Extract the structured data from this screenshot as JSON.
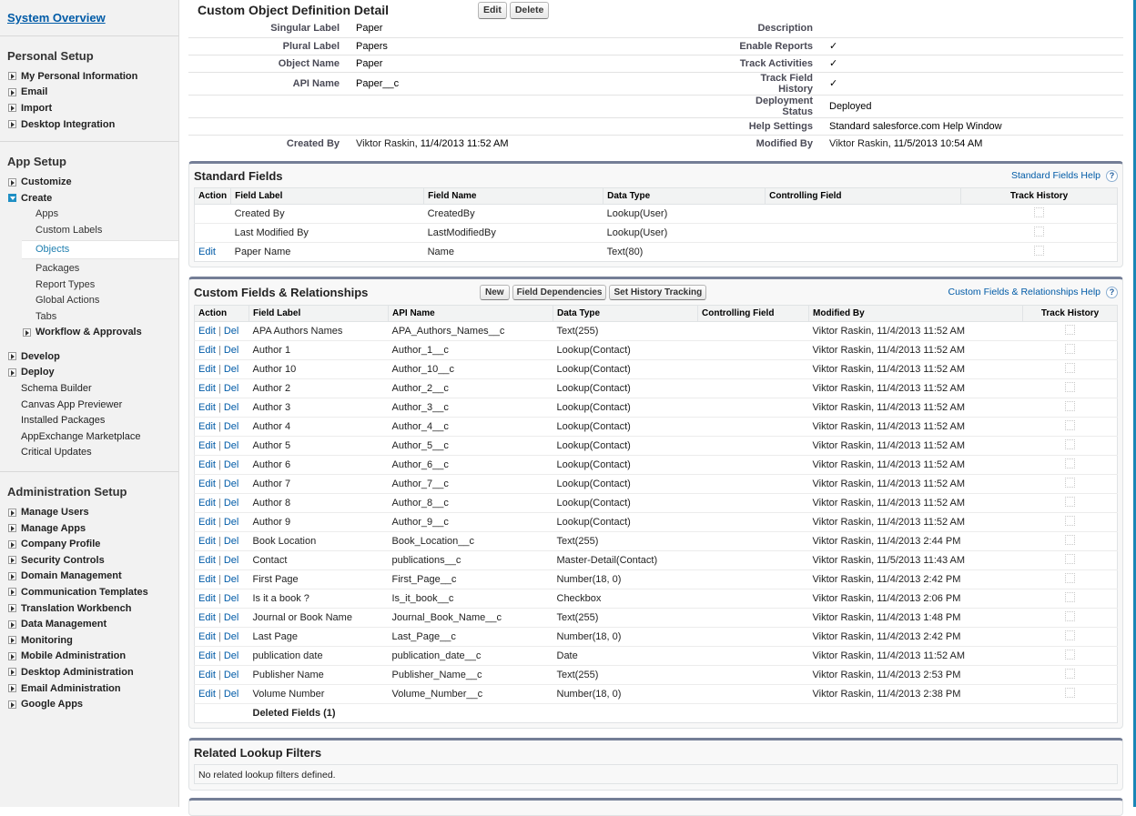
{
  "sidebar": {
    "system_overview": "System Overview",
    "personal_setup": {
      "heading": "Personal Setup",
      "items": [
        "My Personal Information",
        "Email",
        "Import",
        "Desktop Integration"
      ]
    },
    "app_setup": {
      "heading": "App Setup",
      "customize": "Customize",
      "create": "Create",
      "create_children": [
        "Apps",
        "Custom Labels",
        "Objects",
        "Packages",
        "Report Types",
        "Global Actions",
        "Tabs"
      ],
      "workflow": "Workflow & Approvals",
      "develop": "Develop",
      "deploy": "Deploy",
      "plain_items": [
        "Schema Builder",
        "Canvas App Previewer",
        "Installed Packages",
        "AppExchange Marketplace",
        "Critical Updates"
      ]
    },
    "admin_setup": {
      "heading": "Administration Setup",
      "items": [
        "Manage Users",
        "Manage Apps",
        "Company Profile",
        "Security Controls",
        "Domain Management",
        "Communication Templates",
        "Translation Workbench",
        "Data Management",
        "Monitoring",
        "Mobile Administration",
        "Desktop Administration",
        "Email Administration",
        "Google Apps"
      ]
    }
  },
  "detail": {
    "title": "Custom Object Definition Detail",
    "edit_label": "Edit",
    "delete_label": "Delete",
    "left": [
      {
        "label": "Singular Label",
        "value": "Paper"
      },
      {
        "label": "Plural Label",
        "value": "Papers"
      },
      {
        "label": "Object Name",
        "value": "Paper"
      },
      {
        "label": "API Name",
        "value": "Paper__c"
      },
      {
        "label": "",
        "value": ""
      },
      {
        "label": "",
        "value": ""
      }
    ],
    "right": [
      {
        "label": "Description",
        "value": ""
      },
      {
        "label": "Enable Reports",
        "value": "✓"
      },
      {
        "label": "Track Activities",
        "value": "✓"
      },
      {
        "label": "Track Field History",
        "value": "✓"
      },
      {
        "label": "Deployment Status",
        "value": "Deployed"
      },
      {
        "label": "Help Settings",
        "value": "Standard salesforce.com Help Window"
      }
    ],
    "created_by_label": "Created By",
    "created_by_user": "Viktor Raskin",
    "created_by_date": ", 11/4/2013 11:52 AM",
    "modified_by_label": "Modified By",
    "modified_by_user": "Viktor Raskin",
    "modified_by_date": ", 11/5/2013 10:54 AM"
  },
  "standard_fields": {
    "title": "Standard Fields",
    "help": "Standard Fields Help",
    "columns": [
      "Action",
      "Field Label",
      "Field Name",
      "Data Type",
      "Controlling Field",
      "Track History"
    ],
    "rows": [
      {
        "action": "",
        "label": "Created By",
        "name": "CreatedBy",
        "type": "Lookup(User)",
        "controlling": ""
      },
      {
        "action": "",
        "label": "Last Modified By",
        "name": "LastModifiedBy",
        "type": "Lookup(User)",
        "controlling": ""
      },
      {
        "action": "Edit",
        "label": "Paper Name",
        "name": "Name",
        "type": "Text(80)",
        "controlling": ""
      }
    ]
  },
  "custom_fields": {
    "title": "Custom Fields & Relationships",
    "new_label": "New",
    "field_dependencies_label": "Field Dependencies",
    "set_history_label": "Set History Tracking",
    "help": "Custom Fields & Relationships Help",
    "columns": [
      "Action",
      "Field Label",
      "API Name",
      "Data Type",
      "Controlling Field",
      "Modified By",
      "Track History"
    ],
    "edit_label": "Edit",
    "del_label": "Del",
    "sep": "|",
    "rows": [
      {
        "label": "APA Authors Names",
        "api": "APA_Authors_Names__c",
        "type": "Text(255)",
        "user": "Viktor Raskin",
        "date": ", 11/4/2013 11:52 AM"
      },
      {
        "label": "Author 1",
        "api": "Author_1__c",
        "type": "Lookup(Contact)",
        "user": "Viktor Raskin",
        "date": ", 11/4/2013 11:52 AM"
      },
      {
        "label": "Author 10",
        "api": "Author_10__c",
        "type": "Lookup(Contact)",
        "user": "Viktor Raskin",
        "date": ", 11/4/2013 11:52 AM"
      },
      {
        "label": "Author 2",
        "api": "Author_2__c",
        "type": "Lookup(Contact)",
        "user": "Viktor Raskin",
        "date": ", 11/4/2013 11:52 AM"
      },
      {
        "label": "Author 3",
        "api": "Author_3__c",
        "type": "Lookup(Contact)",
        "user": "Viktor Raskin",
        "date": ", 11/4/2013 11:52 AM"
      },
      {
        "label": "Author 4",
        "api": "Author_4__c",
        "type": "Lookup(Contact)",
        "user": "Viktor Raskin",
        "date": ", 11/4/2013 11:52 AM"
      },
      {
        "label": "Author 5",
        "api": "Author_5__c",
        "type": "Lookup(Contact)",
        "user": "Viktor Raskin",
        "date": ", 11/4/2013 11:52 AM"
      },
      {
        "label": "Author 6",
        "api": "Author_6__c",
        "type": "Lookup(Contact)",
        "user": "Viktor Raskin",
        "date": ", 11/4/2013 11:52 AM"
      },
      {
        "label": "Author 7",
        "api": "Author_7__c",
        "type": "Lookup(Contact)",
        "user": "Viktor Raskin",
        "date": ", 11/4/2013 11:52 AM"
      },
      {
        "label": "Author 8",
        "api": "Author_8__c",
        "type": "Lookup(Contact)",
        "user": "Viktor Raskin",
        "date": ", 11/4/2013 11:52 AM"
      },
      {
        "label": "Author 9",
        "api": "Author_9__c",
        "type": "Lookup(Contact)",
        "user": "Viktor Raskin",
        "date": ", 11/4/2013 11:52 AM"
      },
      {
        "label": "Book Location",
        "api": "Book_Location__c",
        "type": "Text(255)",
        "user": "Viktor Raskin",
        "date": ", 11/4/2013 2:44 PM"
      },
      {
        "label": "Contact",
        "api": "publications__c",
        "type": "Master-Detail(Contact)",
        "user": "Viktor Raskin",
        "date": ", 11/5/2013 11:43 AM"
      },
      {
        "label": "First Page",
        "api": "First_Page__c",
        "type": "Number(18, 0)",
        "user": "Viktor Raskin",
        "date": ", 11/4/2013 2:42 PM"
      },
      {
        "label": "Is it a book ?",
        "api": "Is_it_book__c",
        "type": "Checkbox",
        "user": "Viktor Raskin",
        "date": ", 11/4/2013 2:06 PM"
      },
      {
        "label": "Journal or Book Name",
        "api": "Journal_Book_Name__c",
        "type": "Text(255)",
        "user": "Viktor Raskin",
        "date": ", 11/4/2013 1:48 PM"
      },
      {
        "label": "Last Page",
        "api": "Last_Page__c",
        "type": "Number(18, 0)",
        "user": "Viktor Raskin",
        "date": ", 11/4/2013 2:42 PM"
      },
      {
        "label": "publication date",
        "api": "publication_date__c",
        "type": "Date",
        "user": "Viktor Raskin",
        "date": ", 11/4/2013 11:52 AM"
      },
      {
        "label": "Publisher Name",
        "api": "Publisher_Name__c",
        "type": "Text(255)",
        "user": "Viktor Raskin",
        "date": ", 11/4/2013 2:53 PM"
      },
      {
        "label": "Volume Number",
        "api": "Volume_Number__c",
        "type": "Number(18, 0)",
        "user": "Viktor Raskin",
        "date": ", 11/4/2013 2:38 PM"
      }
    ],
    "deleted_fields": "Deleted Fields (1)"
  },
  "lookup_filters": {
    "title": "Related Lookup Filters",
    "empty": "No related lookup filters defined."
  }
}
